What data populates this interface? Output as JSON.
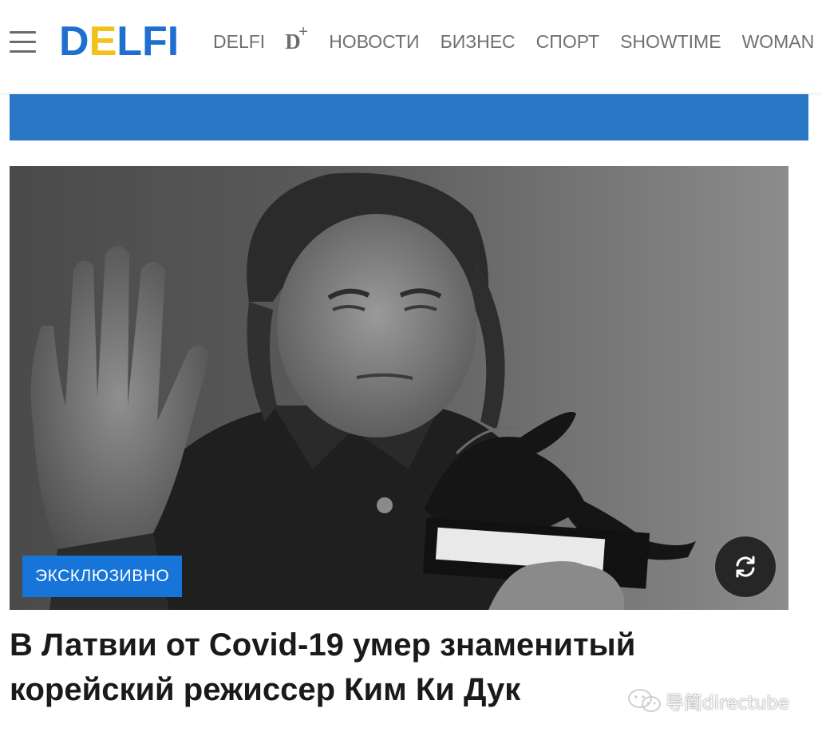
{
  "header": {
    "logo": {
      "part1": "D",
      "part2": "E",
      "part3": "LFI",
      "brand_color": "#1f6fd1",
      "accent_color": "#f2c21b"
    },
    "menu_icon": "hamburger-menu-icon",
    "nav": [
      {
        "label": "DELFI"
      },
      {
        "label": "D",
        "suffix": "+"
      },
      {
        "label": "НОВОСТИ"
      },
      {
        "label": "БИЗНЕС"
      },
      {
        "label": "СПОРТ"
      },
      {
        "label": "SHOWTIME"
      },
      {
        "label": "WOMAN"
      }
    ]
  },
  "banner": {
    "color": "#2a78c5"
  },
  "article": {
    "badge": "ЭКСКЛЮЗИВНО",
    "badge_color": "#1774d9",
    "refresh_icon": "refresh-icon",
    "headline": "В Латвии от Covid-19 умер знаменитый корейский режиссер Ким Ки Дук"
  },
  "watermark": {
    "text": "导简directube",
    "icon": "wechat-icon"
  }
}
